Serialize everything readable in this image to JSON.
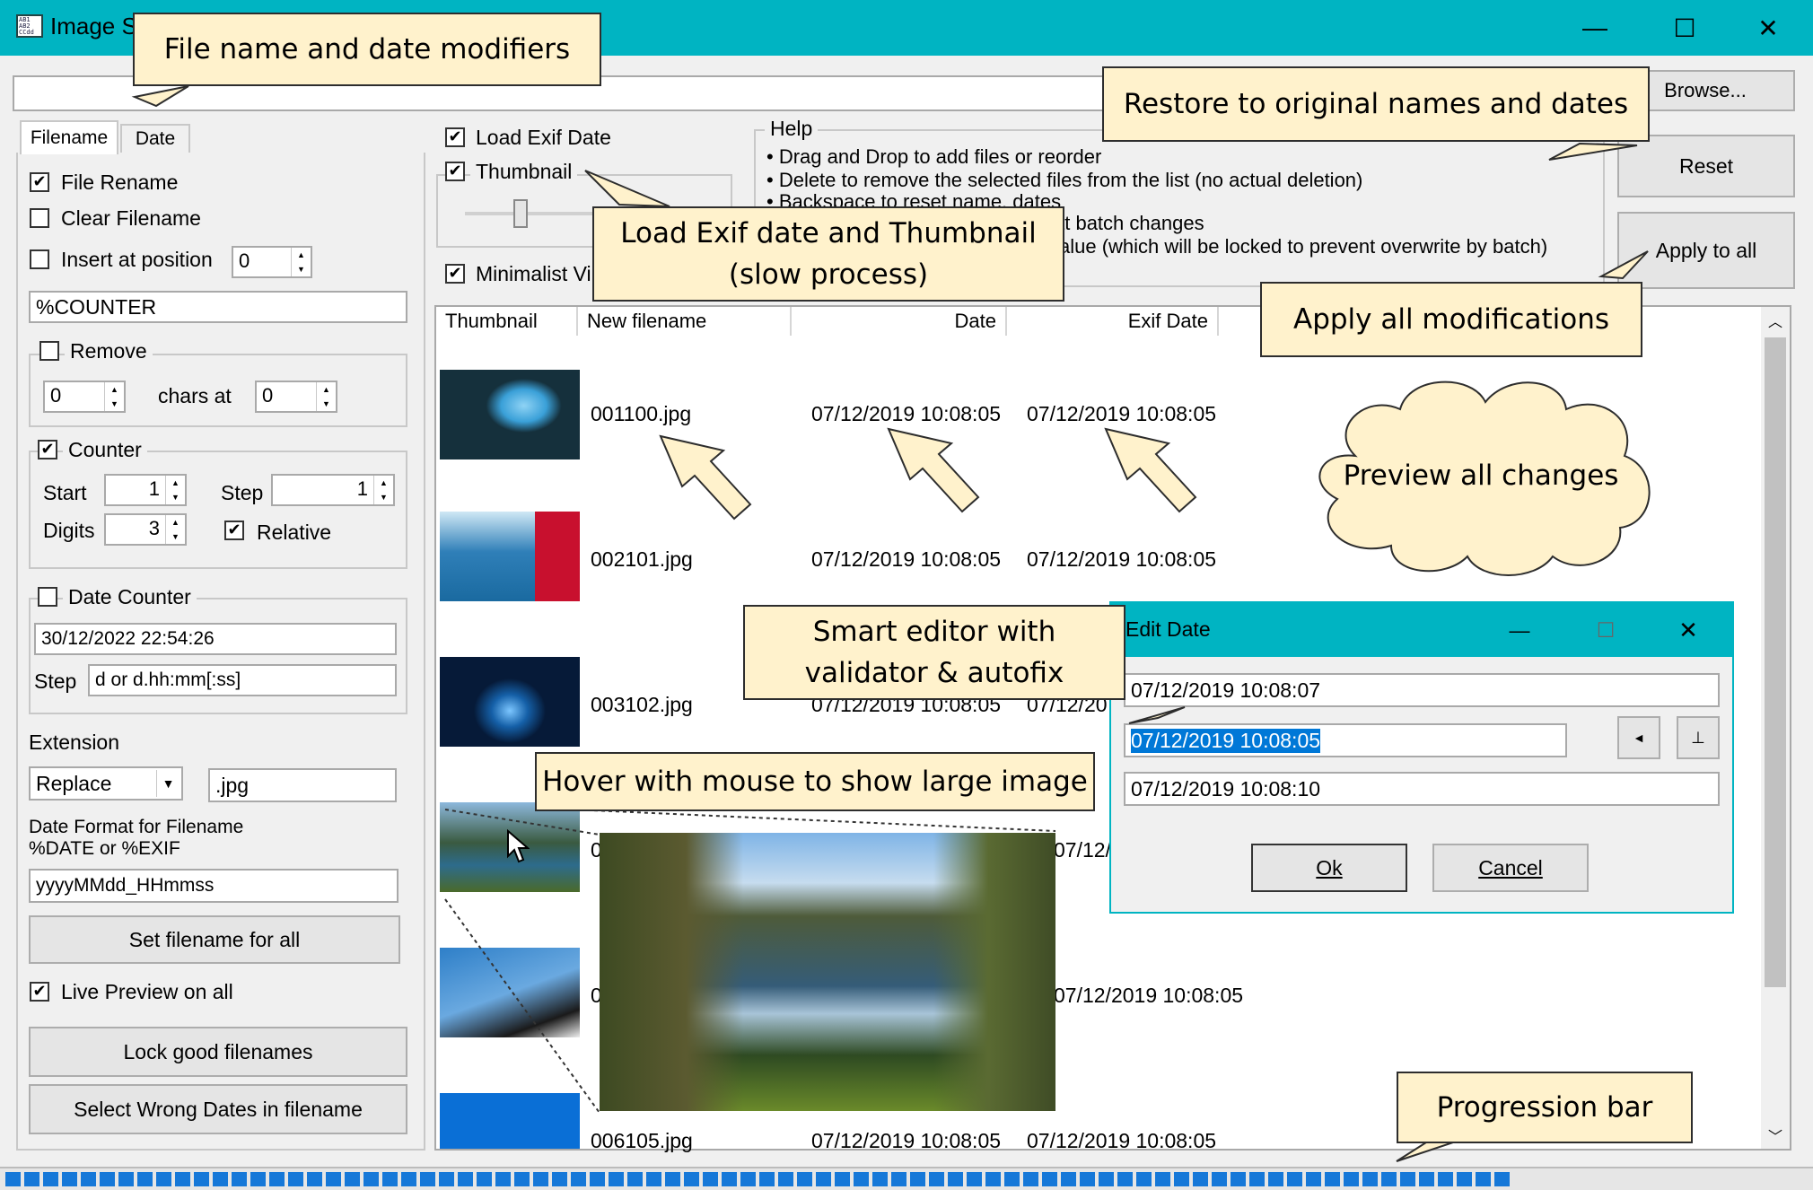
{
  "window": {
    "title": "Image So",
    "minimize_glyph": "—",
    "maximize_glyph": "☐",
    "close_glyph": "✕"
  },
  "toolbar": {
    "path_value": "",
    "browse_label": "Browse...",
    "reset_label": "Reset",
    "apply_label": "Apply to all"
  },
  "left_panel": {
    "tabs": [
      "Filename",
      "Date"
    ],
    "file_rename": "File Rename",
    "clear_filename": "Clear Filename",
    "insert_at_position": "Insert at position",
    "insert_value": "0",
    "pattern_value": "%COUNTER",
    "remove_label": "Remove",
    "remove_count": "0",
    "chars_at_label": "chars at",
    "chars_at_value": "0",
    "counter_label": "Counter",
    "start_label": "Start",
    "start_value": "1",
    "step_label": "Step",
    "step_value": "1",
    "digits_label": "Digits",
    "digits_value": "3",
    "relative_label": "Relative",
    "date_counter_label": "Date Counter",
    "date_counter_value": "30/12/2022 22:54:26",
    "date_step_label": "Step",
    "date_step_value": "d or d.hh:mm[:ss]",
    "extension_label": "Extension",
    "extension_mode": "Replace",
    "extension_value": ".jpg",
    "date_format_label_1": "Date Format for Filename",
    "date_format_label_2": "%DATE or %EXIF",
    "date_format_value": "yyyyMMdd_HHmmss",
    "set_filename_button": "Set filename for all",
    "live_preview_label": "Live Preview on all",
    "lock_good_button": "Lock good filenames",
    "select_wrong_button": "Select Wrong Dates in filename"
  },
  "options": {
    "load_exif_label": "Load Exif Date",
    "thumbnail_label": "Thumbnail",
    "minimalist_label": "Minimalist Vi"
  },
  "help": {
    "title": "Help",
    "line1": "• Drag and Drop to add files or reorder",
    "line2": "• Delete to remove the selected files from the list (no actual deletion)",
    "line3": "• Backspace to reset name, dates",
    "line4": "at batch changes",
    "line5": "alue (which will be locked to prevent overwrite by batch)"
  },
  "list": {
    "columns": [
      "Thumbnail",
      "New filename",
      "Date",
      "Exif Date"
    ],
    "rows": [
      {
        "filename": "001100.jpg",
        "date": "07/12/2019 10:08:05",
        "exif": "07/12/2019 10:08:05"
      },
      {
        "filename": "002101.jpg",
        "date": "07/12/2019 10:08:05",
        "exif": "07/12/2019 10:08:05"
      },
      {
        "filename": "003102.jpg",
        "date": "07/12/2019 10:08:05",
        "exif": "07/12/20"
      },
      {
        "filename": "0",
        "date": "",
        "exif": "07/12/20"
      },
      {
        "filename": "0",
        "date": "",
        "exif": "07/12/2019 10:08:05"
      },
      {
        "filename": "006105.jpg",
        "date": "07/12/2019 10:08:05",
        "exif": "07/12/2019 10:08:05"
      }
    ],
    "scroll_up": "︿",
    "scroll_down": "﹀"
  },
  "edit_date": {
    "title": "Edit Date",
    "minimize_glyph": "—",
    "maximize_glyph": "☐",
    "close_glyph": "✕",
    "prev_value": "07/12/2019 10:08:07",
    "current_value": "07/12/2019 10:08:05",
    "next_value": "07/12/2019 10:08:10",
    "ok_label": "Ok",
    "cancel_label": "Cancel"
  },
  "callouts": {
    "modifiers": "File name and date modifiers",
    "restore": "Restore to original names and dates",
    "exif_thumb_1": "Load Exif date and Thumbnail",
    "exif_thumb_2": "(slow process)",
    "apply_all": "Apply all modifications",
    "preview": "Preview all changes",
    "smart_editor_1": "Smart editor with",
    "smart_editor_2": "validator & autofix",
    "hover": "Hover with mouse to show large image",
    "progress": "Progression bar"
  },
  "progress": {
    "fraction": 0.84
  },
  "colors": {
    "titlebar": "#00b4c2",
    "callout": "#fff2cc",
    "progress": "#1678d8",
    "selection": "#0078d7"
  }
}
